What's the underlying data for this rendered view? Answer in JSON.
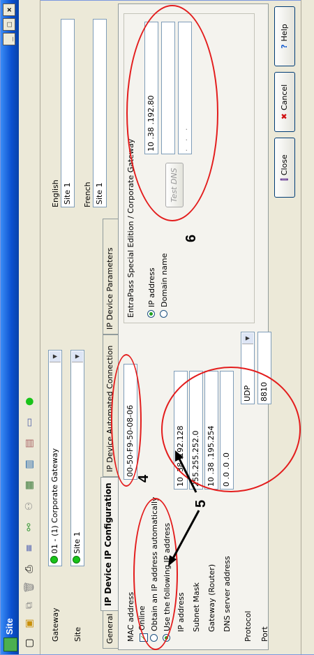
{
  "window": {
    "title": "Site"
  },
  "header": {
    "gateway_label": "Gateway",
    "gateway_value": "01 - (1) Corporate Gateway",
    "site_label": "Site",
    "site_value": "Site 1",
    "english_label": "English",
    "english_value": "Site 1",
    "french_label": "French",
    "french_value": "Site 1"
  },
  "tabs": [
    "General",
    "IP Device IP Configuration",
    "IP Device Automated Connection",
    "IP Device Parameters"
  ],
  "ipconfig": {
    "mac_label": "MAC address",
    "mac_value": "00-50-F9-50-08-06",
    "online_label": "Online",
    "obtain_auto_label": "Obtain an IP address automatically",
    "use_following_label": "Use the following IP address",
    "ip_label": "IP address",
    "ip_value": "10 .38 .192.128",
    "subnet_label": "Subnet Mask",
    "subnet_value": "255.255.252.0",
    "gateway_label": "Gateway (Router)",
    "gateway_value": "10 .38 .195.254",
    "dns_label": "DNS server address",
    "dns_value": "0 .0 .0 .0",
    "protocol_label": "Protocol",
    "protocol_value": "UDP",
    "port_label": "Port",
    "port_value": "8810"
  },
  "corporate_gateway": {
    "title": "EntraPass Special Edition / Corporate Gateway",
    "ip_option": "IP address",
    "domain_option": "Domain name",
    "address_value": "10 .38 .192.80",
    "blank_value": "",
    "dots_value": ". . .",
    "test_dns": "Test DNS"
  },
  "buttons": {
    "close": "Close",
    "cancel": "Cancel",
    "help": "Help"
  },
  "annotations": {
    "a4": "4",
    "a5": "5",
    "a6": "6"
  },
  "colors": {
    "annotation": "#e31d1d",
    "title_bar": "#0a50d0",
    "status_green": "#19c319"
  }
}
